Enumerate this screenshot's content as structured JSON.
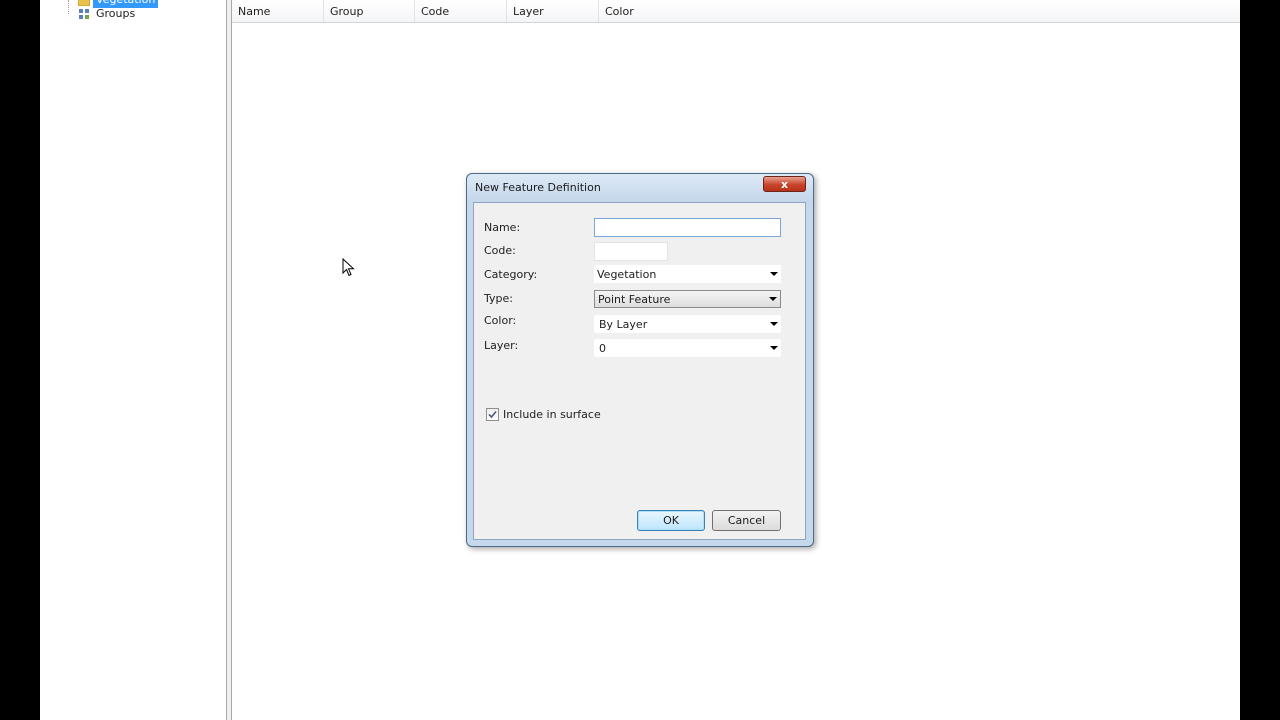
{
  "tree": {
    "items": [
      {
        "label": "Vegetation",
        "selected": true,
        "icon": "folder-icon"
      },
      {
        "label": "Groups",
        "selected": false,
        "icon": "groups-icon"
      }
    ]
  },
  "list": {
    "columns": [
      {
        "label": "Name"
      },
      {
        "label": "Group"
      },
      {
        "label": "Code"
      },
      {
        "label": "Layer"
      },
      {
        "label": "Color"
      }
    ]
  },
  "dialog": {
    "title": "New Feature Definition",
    "close_label": "x",
    "fields": {
      "name_label": "Name:",
      "name_value": "",
      "code_label": "Code:",
      "code_value": "",
      "category_label": "Category:",
      "category_value": "Vegetation",
      "type_label": "Type:",
      "type_value": "Point Feature",
      "color_label": "Color:",
      "color_value": "By Layer",
      "layer_label": "Layer:",
      "layer_value": "0"
    },
    "include_in_surface": {
      "label": "Include in surface",
      "checked": true
    },
    "ok_label": "OK",
    "cancel_label": "Cancel"
  },
  "colors": {
    "selection": "#3399ff",
    "close_button": "#c7442b",
    "default_button_border": "#3c7fb1"
  }
}
